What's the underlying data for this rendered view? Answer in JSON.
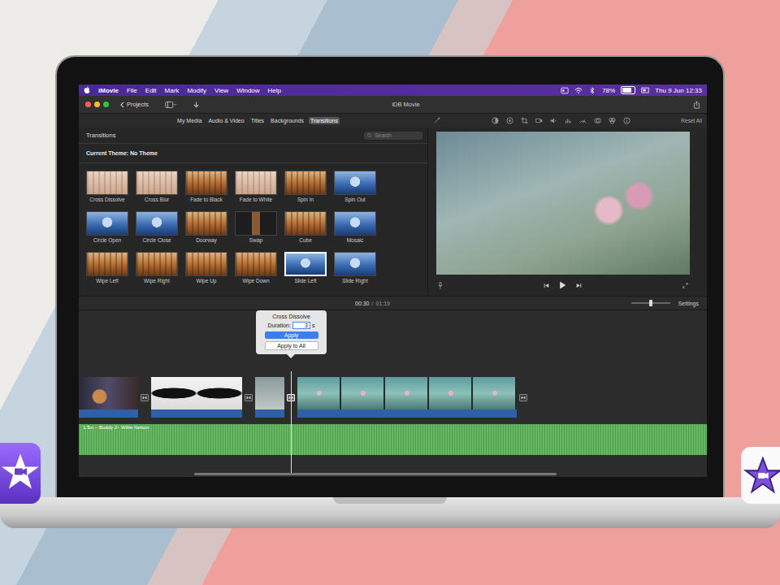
{
  "menu_bar": {
    "app": "iMovie",
    "items": [
      "File",
      "Edit",
      "Mark",
      "Modify",
      "View",
      "Window",
      "Help"
    ],
    "battery": "78%",
    "battery_level": 0.78,
    "clock": "Thu 9 Jun 12:33"
  },
  "window": {
    "title": "iDB Movie",
    "back": "Projects"
  },
  "tabs": [
    {
      "label": "My Media",
      "selected": false
    },
    {
      "label": "Audio & Video",
      "selected": false
    },
    {
      "label": "Titles",
      "selected": false
    },
    {
      "label": "Backgrounds",
      "selected": false
    },
    {
      "label": "Transitions",
      "selected": true
    }
  ],
  "browser": {
    "title": "Transitions",
    "search_placeholder": "Search",
    "theme": "Current Theme: No Theme",
    "transitions": [
      {
        "label": "Cross Dissolve",
        "kind": "faded",
        "selected": false
      },
      {
        "label": "Cross Blur",
        "kind": "faded",
        "selected": false
      },
      {
        "label": "Fade to Black",
        "kind": "forest",
        "selected": false
      },
      {
        "label": "Fade to White",
        "kind": "faded",
        "selected": false
      },
      {
        "label": "Spin In",
        "kind": "forest",
        "selected": false
      },
      {
        "label": "Spin Out",
        "kind": "lake",
        "selected": false
      },
      {
        "label": "Circle Open",
        "kind": "lake",
        "selected": false
      },
      {
        "label": "Circle Close",
        "kind": "lake",
        "selected": false
      },
      {
        "label": "Doorway",
        "kind": "forest",
        "selected": false
      },
      {
        "label": "Swap",
        "kind": "dark",
        "selected": false
      },
      {
        "label": "Cube",
        "kind": "forest",
        "selected": false
      },
      {
        "label": "Mosaic",
        "kind": "lake",
        "selected": false
      },
      {
        "label": "Wipe Left",
        "kind": "forest",
        "selected": false
      },
      {
        "label": "Wipe Right",
        "kind": "forest",
        "selected": false
      },
      {
        "label": "Wipe Up",
        "kind": "forest",
        "selected": false
      },
      {
        "label": "Wipe Down",
        "kind": "forest",
        "selected": false
      },
      {
        "label": "Slide Left",
        "kind": "lake",
        "selected": true
      },
      {
        "label": "Slide Right",
        "kind": "lake",
        "selected": false
      }
    ]
  },
  "viewer": {
    "reset": "Reset All",
    "playing": false
  },
  "timeline_bar": {
    "current": "00:30",
    "separator": "/",
    "total": "01:19",
    "zoom_level": 0.5,
    "settings": "Settings"
  },
  "popover": {
    "title": "Cross Dissolve",
    "duration_label": "Duration:",
    "duration": "3",
    "unit": "s",
    "apply": "Apply",
    "apply_all": "Apply to All"
  },
  "track": [
    {
      "kind": "guitar",
      "selected": false
    },
    {
      "kind": "transition",
      "selected": false
    },
    {
      "kind": "cats",
      "selected": false
    },
    {
      "kind": "transition",
      "selected": false
    },
    {
      "kind": "still",
      "selected": false
    },
    {
      "kind": "transition",
      "selected": true
    },
    {
      "kind": "lilies",
      "selected": false
    },
    {
      "kind": "transition",
      "selected": false
    }
  ],
  "audio": {
    "label": "1.5m – Buddy 2– Willie Nelson"
  }
}
